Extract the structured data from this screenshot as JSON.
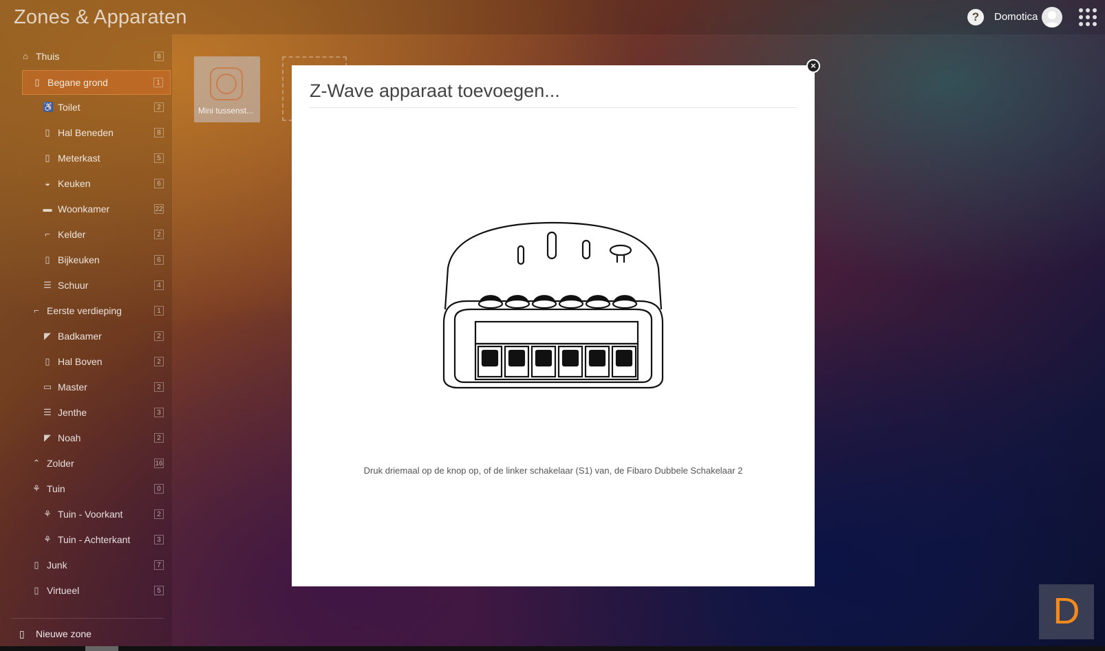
{
  "header": {
    "title": "Zones & Apparaten",
    "user_name": "Domotica",
    "help_glyph": "?"
  },
  "sidebar": {
    "items": [
      {
        "label": "Thuis",
        "count": "8",
        "icon": "home-icon"
      },
      {
        "label": "Begane grond",
        "count": "1",
        "icon": "door-icon",
        "active": true
      },
      {
        "label": "Toilet",
        "count": "2",
        "icon": "toilet-icon"
      },
      {
        "label": "Hal Beneden",
        "count": "8",
        "icon": "door-icon"
      },
      {
        "label": "Meterkast",
        "count": "5",
        "icon": "door-icon"
      },
      {
        "label": "Keuken",
        "count": "6",
        "icon": "pot-icon"
      },
      {
        "label": "Woonkamer",
        "count": "22",
        "icon": "sofa-icon"
      },
      {
        "label": "Kelder",
        "count": "2",
        "icon": "stairs-icon"
      },
      {
        "label": "Bijkeuken",
        "count": "6",
        "icon": "door-icon"
      },
      {
        "label": "Schuur",
        "count": "4",
        "icon": "shed-icon"
      },
      {
        "label": "Eerste verdieping",
        "count": "1",
        "icon": "stairs-icon"
      },
      {
        "label": "Badkamer",
        "count": "2",
        "icon": "shower-icon"
      },
      {
        "label": "Hal Boven",
        "count": "2",
        "icon": "door-icon"
      },
      {
        "label": "Master",
        "count": "2",
        "icon": "bed-icon"
      },
      {
        "label": "Jenthe",
        "count": "3",
        "icon": "shed-icon"
      },
      {
        "label": "Noah",
        "count": "2",
        "icon": "shower-icon"
      },
      {
        "label": "Zolder",
        "count": "16",
        "icon": "roof-icon"
      },
      {
        "label": "Tuin",
        "count": "0",
        "icon": "plant-icon"
      },
      {
        "label": "Tuin - Voorkant",
        "count": "2",
        "icon": "plant-icon"
      },
      {
        "label": "Tuin - Achterkant",
        "count": "3",
        "icon": "plant-icon"
      },
      {
        "label": "Junk",
        "count": "7",
        "icon": "door-icon"
      },
      {
        "label": "Virtueel",
        "count": "5",
        "icon": "door-icon"
      }
    ],
    "new_zone_label": "Nieuwe zone"
  },
  "devices": [
    {
      "label": "Mini tussenst...",
      "icon": "socket-icon"
    }
  ],
  "modal": {
    "title": "Z-Wave apparaat toevoegen...",
    "instruction": "Druk driemaal op de knop op, of de linker schakelaar (S1) van, de Fibaro Dubbele Schakelaar 2",
    "close_glyph": "×"
  },
  "brand_tile": {
    "letter": "D",
    "color": "#f08a1c"
  }
}
